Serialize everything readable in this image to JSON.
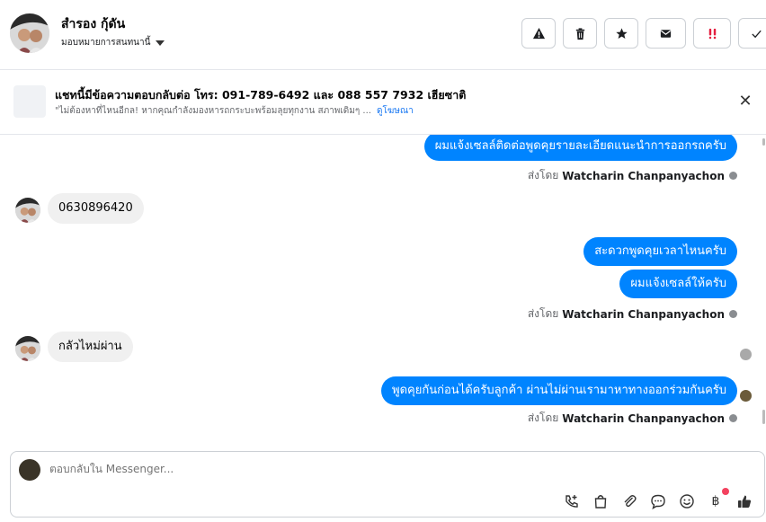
{
  "header": {
    "contact_name": "สำรอง กุ้ดัน",
    "assign_label": "มอบหมายการสนทนานี้",
    "actions": [
      "spam",
      "delete",
      "star",
      "mark-unread",
      "follow-up",
      "done"
    ]
  },
  "banner": {
    "title": "แชทนี้มีข้อความตอบกลับต่อ โทร: 091-789-6492 และ 088 557 7932 เฮียซาติ",
    "subtitle": "\"ไม่ต้องหาที่ไหนอีกล! หากคุณกำลังมองหารถกระบะพร้อมลุยทุกงาน สภาพเดิมๆ ...",
    "link": "ดูโฆษณา",
    "close": "✕"
  },
  "messages": [
    {
      "direction": "out",
      "text": "ผมแจ้งเซลล์ติดต่อพูดคุยรายละเอียดแนะนำการออกรถครับ"
    },
    {
      "type": "sent_by",
      "prefix": "ส่งโดย",
      "name": "Watcharin Chanpanyachon"
    },
    {
      "direction": "in",
      "text": "0630896420"
    },
    {
      "direction": "out",
      "text": "สะดวกพูดคุยเวลาไหนครับ"
    },
    {
      "direction": "out",
      "text": "ผมแจ้งเซลล์ให้ครับ"
    },
    {
      "type": "sent_by",
      "prefix": "ส่งโดย",
      "name": "Watcharin Chanpanyachon"
    },
    {
      "direction": "in",
      "text": "กลัวไหม่ผ่าน"
    },
    {
      "direction": "out",
      "text": "พูดคุยกันก่อนได้ครับลูกค้า ผ่านไม่ผ่านเรามาหาทางออกร่วมกันครับ"
    },
    {
      "type": "sent_by",
      "prefix": "ส่งโดย",
      "name": "Watcharin Chanpanyachon"
    }
  ],
  "composer": {
    "placeholder": "ตอบกลับใน Messenger...",
    "tools": [
      "add-call-icon",
      "shopping-bag-icon",
      "attachment-icon",
      "saved-reply-icon",
      "emoji-icon",
      "baht-icon",
      "thumbs-up-icon"
    ],
    "baht_symbol": "฿"
  },
  "colors": {
    "outgoing_bubble": "#0084ff",
    "incoming_bubble": "#f0f0f0",
    "notification_dot": "#f3425f",
    "follow_up_icon": "#e41e3f"
  }
}
